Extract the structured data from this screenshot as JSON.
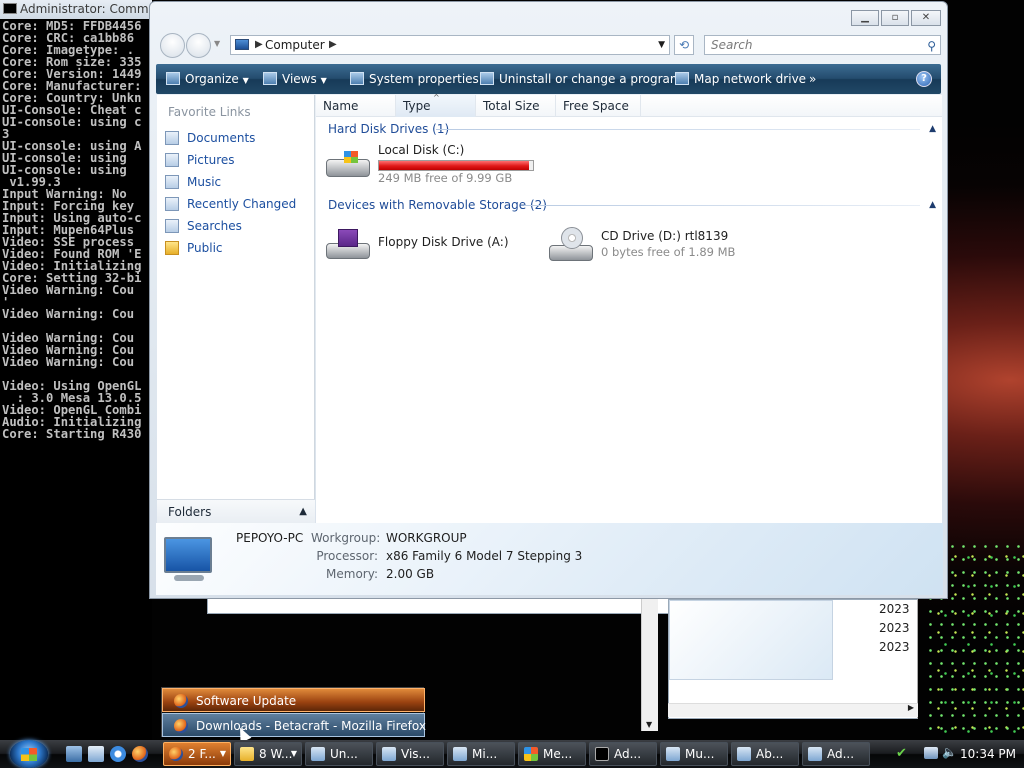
{
  "cmd": {
    "title": "Administrator: Comman",
    "lines": [
      "Core: MD5: FFDB4456",
      "Core: CRC: ca1bb86",
      "Core: Imagetype: .",
      "Core: Rom size: 335",
      "Core: Version: 1449",
      "Core: Manufacturer:",
      "Core: Country: Unkn",
      "UI-Console: Cheat c",
      "UI-console: using c",
      "3",
      "UI-console: using A",
      "UI-console: using ",
      "UI-console: using ",
      " v1.99.3",
      "Input Warning: No ",
      "Input: Forcing key",
      "Input: Using auto-c",
      "Input: Mupen64Plus ",
      "Video: SSE process",
      "Video: Found ROM 'E",
      "Video: Initializing",
      "Core: Setting 32-bi",
      "Video Warning: Cou",
      "'",
      "Video Warning: Cou",
      "",
      "Video Warning: Cou",
      "Video Warning: Cou",
      "Video Warning: Cou",
      "",
      "Video: Using OpenGL",
      "  : 3.0 Mesa 13.0.5",
      "Video: OpenGL Combi",
      "Audio: Initializing",
      "Core: Starting R430"
    ]
  },
  "explorer": {
    "address": "Computer",
    "search_placeholder": "Search",
    "toolbar": {
      "organize": "Organize",
      "views": "Views",
      "system_properties": "System properties",
      "uninstall": "Uninstall or change a program",
      "map_drive": "Map network drive",
      "more": "»",
      "help": "?"
    },
    "favorite_links_title": "Favorite Links",
    "favorites": [
      "Documents",
      "Pictures",
      "Music",
      "Recently Changed",
      "Searches",
      "Public"
    ],
    "folders_label": "Folders",
    "columns": [
      "Name",
      "Type",
      "Total Size",
      "Free Space"
    ],
    "groups": [
      {
        "title": "Hard Disk Drives (1)",
        "items": [
          {
            "name": "Local Disk (C:)",
            "free": "249 MB free of 9.99 GB",
            "used_fraction": 0.975
          }
        ]
      },
      {
        "title": "Devices with Removable Storage (2)",
        "items": [
          {
            "name": "Floppy Disk Drive (A:)",
            "free": ""
          },
          {
            "name": "CD Drive (D:) rtl8139",
            "free": "0 bytes free of 1.89 MB"
          }
        ]
      }
    ],
    "details": {
      "computer_name": "PEPOYO-PC",
      "workgroup_label": "Workgroup:",
      "workgroup": "WORKGROUP",
      "processor_label": "Processor:",
      "processor": "x86 Family 6 Model 7 Stepping 3",
      "memory_label": "Memory:",
      "memory": "2.00 GB"
    }
  },
  "background_window": {
    "dates": [
      "2023",
      "2023",
      "2023"
    ]
  },
  "jumplist": {
    "items": [
      "Software Update",
      "Downloads - Betacraft - Mozilla Firefox"
    ]
  },
  "taskbar": {
    "tasks": [
      "2 F...",
      "8 W...",
      "Un...",
      "Vis...",
      "Mi...",
      "Me...",
      "Ad...",
      "Mu...",
      "Ab...",
      "Ad..."
    ],
    "clock": "10:34 PM"
  },
  "colors": {
    "accent": "#2b5797",
    "link": "#1c4fa0",
    "disk_bar": "#e01818"
  }
}
